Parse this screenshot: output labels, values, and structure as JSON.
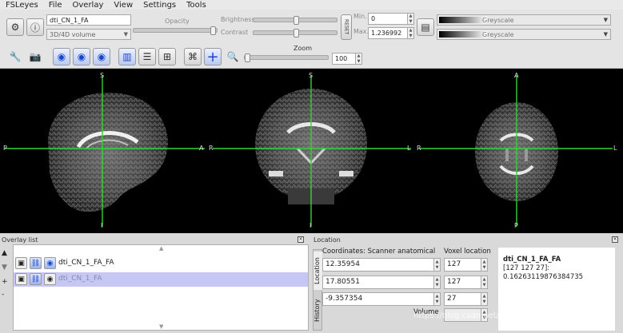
{
  "menu": [
    "FSLeyes",
    "File",
    "Overlay",
    "View",
    "Settings",
    "Tools"
  ],
  "toolbar": {
    "overlay_name": "dti_CN_1_FA",
    "overlay_type": "3D/4D volume",
    "opacity_label": "Opacity",
    "brightness_label": "Brightness",
    "contrast_label": "Contrast",
    "reset_label": "RESET",
    "min_label": "Min.",
    "max_label": "Max.",
    "min_value": "0",
    "max_value": "1.236992",
    "cmap1": "Greyscale",
    "cmap2": "Greyscale",
    "zoom_label": "Zoom",
    "zoom_value": "100"
  },
  "viewer": {
    "sagittal": {
      "top": "S",
      "bottom": "I",
      "left": "P",
      "right": "A"
    },
    "coronal": {
      "top": "S",
      "bottom": "I",
      "left": "R",
      "right": "L"
    },
    "axial": {
      "top": "A",
      "bottom": "P",
      "left": "R",
      "right": "L"
    },
    "crosshair_color": "#35d135"
  },
  "overlay_list": {
    "title": "Overlay list",
    "items": [
      {
        "name": "dti_CN_1_FA_FA",
        "selected": false
      },
      {
        "name": "dti_CN_1_FA",
        "selected": true
      }
    ]
  },
  "location": {
    "title": "Location",
    "tabs": [
      "Location",
      "History"
    ],
    "coord_header": "Coordinates: Scanner anatomical",
    "voxel_header": "Voxel location",
    "coords": [
      "12.35954",
      "17.80551",
      "-9.357354"
    ],
    "voxels": [
      "127",
      "127",
      "27"
    ],
    "volume_label": "Volume",
    "info_name": "dti_CN_1_FA_FA",
    "info_voxel": "[127 127 27]:",
    "info_value": "0.16263119876384735"
  },
  "watermark": "https://blog.csdn.net/m0_51644024"
}
